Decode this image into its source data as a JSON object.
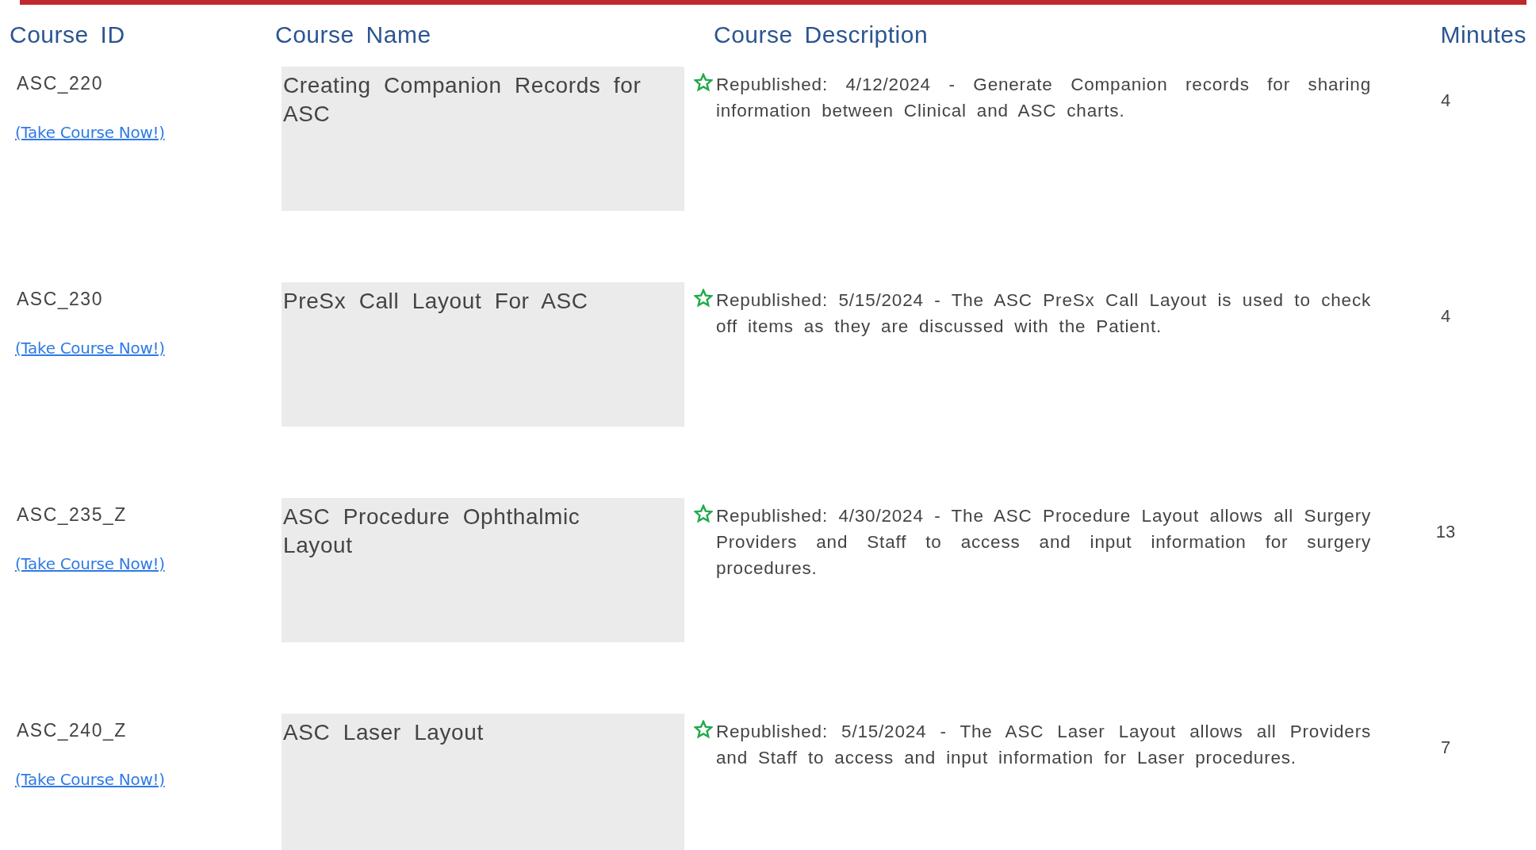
{
  "columns": [
    "Course ID",
    "Course Name",
    "Course Description",
    "Minutes"
  ],
  "courses": [
    {
      "id": "ASC_220",
      "link": "(Take Course Now!)",
      "name": "Creating Companion Records for ASC",
      "description": "Republished: 4/12/2024 - Generate Companion records for sharing information between Clinical and ASC charts.",
      "minutes": "4"
    },
    {
      "id": "ASC_230",
      "link": "(Take Course Now!)",
      "name": "PreSx Call Layout For ASC",
      "description": "Republished: 5/15/2024 - The ASC PreSx Call Layout is used to check off items as they are discussed with the Patient.",
      "minutes": "4"
    },
    {
      "id": "ASC_235_Z",
      "link": "(Take Course Now!)",
      "name": "ASC Procedure Ophthalmic Layout",
      "description": "Republished: 4/30/2024 - The ASC Procedure Layout allows all Surgery Providers and Staff to access and input information for surgery procedures.",
      "minutes": "13"
    },
    {
      "id": "ASC_240_Z",
      "link": "(Take Course Now!)",
      "name": "ASC Laser Layout",
      "description": "Republished: 5/15/2024 - The ASC Laser Layout allows all Providers and Staff to access and input information for Laser procedures.",
      "minutes": "7"
    }
  ]
}
